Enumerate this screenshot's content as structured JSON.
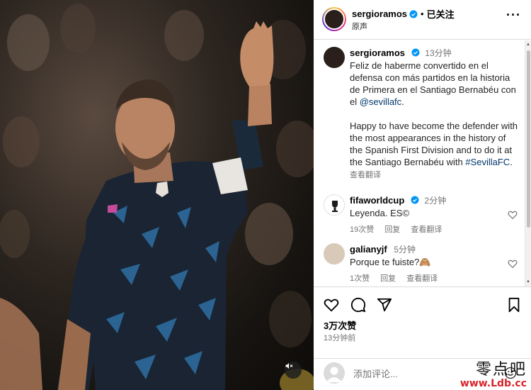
{
  "header": {
    "username": "sergioramos",
    "follow_status": "已关注",
    "audio_label": "原声",
    "more_icon": "more-horizontal-icon"
  },
  "comments": [
    {
      "username": "sergioramos",
      "time": "13分钟",
      "text_es": "Feliz de haberme convertido en el defensa con más partidos en la historia de Primera en el Santiago Bernabéu con el ",
      "mention": "@sevillafc",
      "text_es_end": ".",
      "text_en": "Happy to have become the defender with the most appearances in the history of the Spanish First Division and to do it at the Santiago Bernabéu with ",
      "hashtag": "#SevillaFC",
      "text_en_end": ".",
      "translate": "查看翻译"
    },
    {
      "username": "fifaworldcup",
      "time": "2分钟",
      "text": "Leyenda. ES©",
      "likes": "19次赞",
      "reply": "回复",
      "translate": "查看翻译"
    },
    {
      "username": "galianyjf",
      "time": "5分钟",
      "text": "Porque te fuiste?🙈",
      "likes": "1次赞",
      "reply": "回复",
      "translate": "查看翻译"
    }
  ],
  "actions": {
    "likes": "3万次赞",
    "posted": "13分钟前"
  },
  "add_comment": {
    "placeholder": "添加评论..."
  },
  "watermark": {
    "name": "零点吧",
    "url": "www.Ldb.cc"
  },
  "colors": {
    "verified": "#0095f6",
    "link": "#00376b",
    "secondary_text": "#737373",
    "watermark_url": "#d8232a"
  }
}
